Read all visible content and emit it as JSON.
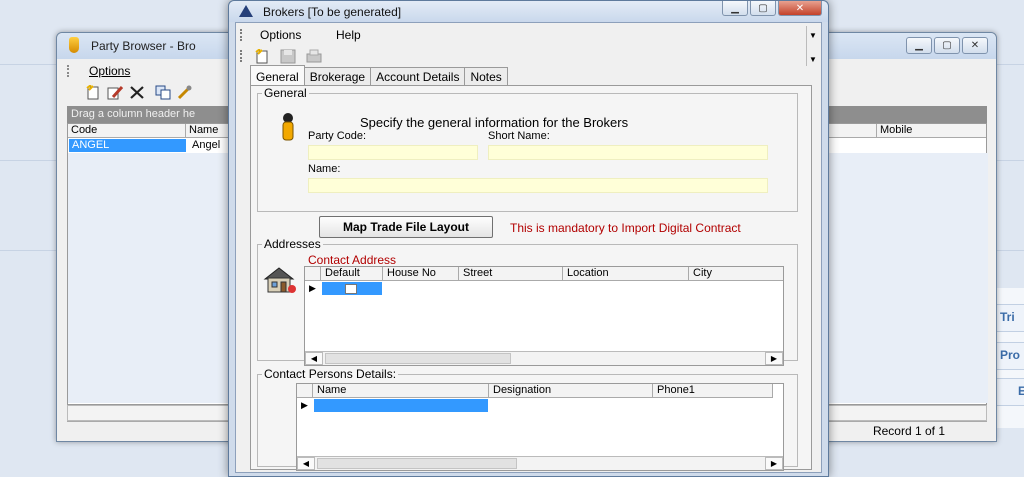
{
  "party_browser": {
    "title": "Party Browser - Bro",
    "menu": {
      "options": "Options"
    },
    "group_bar": "Drag a column header he",
    "columns": {
      "code": "Code",
      "name": "Name",
      "mobile": "Mobile"
    },
    "row": {
      "code": "ANGEL",
      "name": "Angel"
    },
    "record_status": "Record 1 of 1"
  },
  "background_app": {
    "labels": [
      "Tri",
      "Pro",
      "E"
    ]
  },
  "brokers": {
    "title": "Brokers  [To be generated]",
    "menu": {
      "options": "Options",
      "help": "Help"
    },
    "tabs": [
      "General",
      "Brokerage",
      "Account Details",
      "Notes"
    ],
    "active_tab": "General",
    "general": {
      "legend": "General",
      "heading": "Specify the general information for the Brokers",
      "party_code_label": "Party Code:",
      "party_code_value": "",
      "short_name_label": "Short Name:",
      "short_name_value": "",
      "name_label": "Name:",
      "name_value": ""
    },
    "map_button": "Map Trade File Layout",
    "mandatory_note": "This is mandatory to Import Digital Contract",
    "addresses": {
      "legend": "Addresses",
      "sub_title": "Contact Address",
      "columns": [
        "Default",
        "House No",
        "Street",
        "Location",
        "City"
      ]
    },
    "contacts": {
      "legend": "Contact Persons Details:",
      "columns": [
        "Name",
        "Designation",
        "Phone1"
      ]
    }
  },
  "colors": {
    "selection": "#3399ff",
    "required_field": "#ffffd8",
    "mandatory_text": "#b20000"
  }
}
